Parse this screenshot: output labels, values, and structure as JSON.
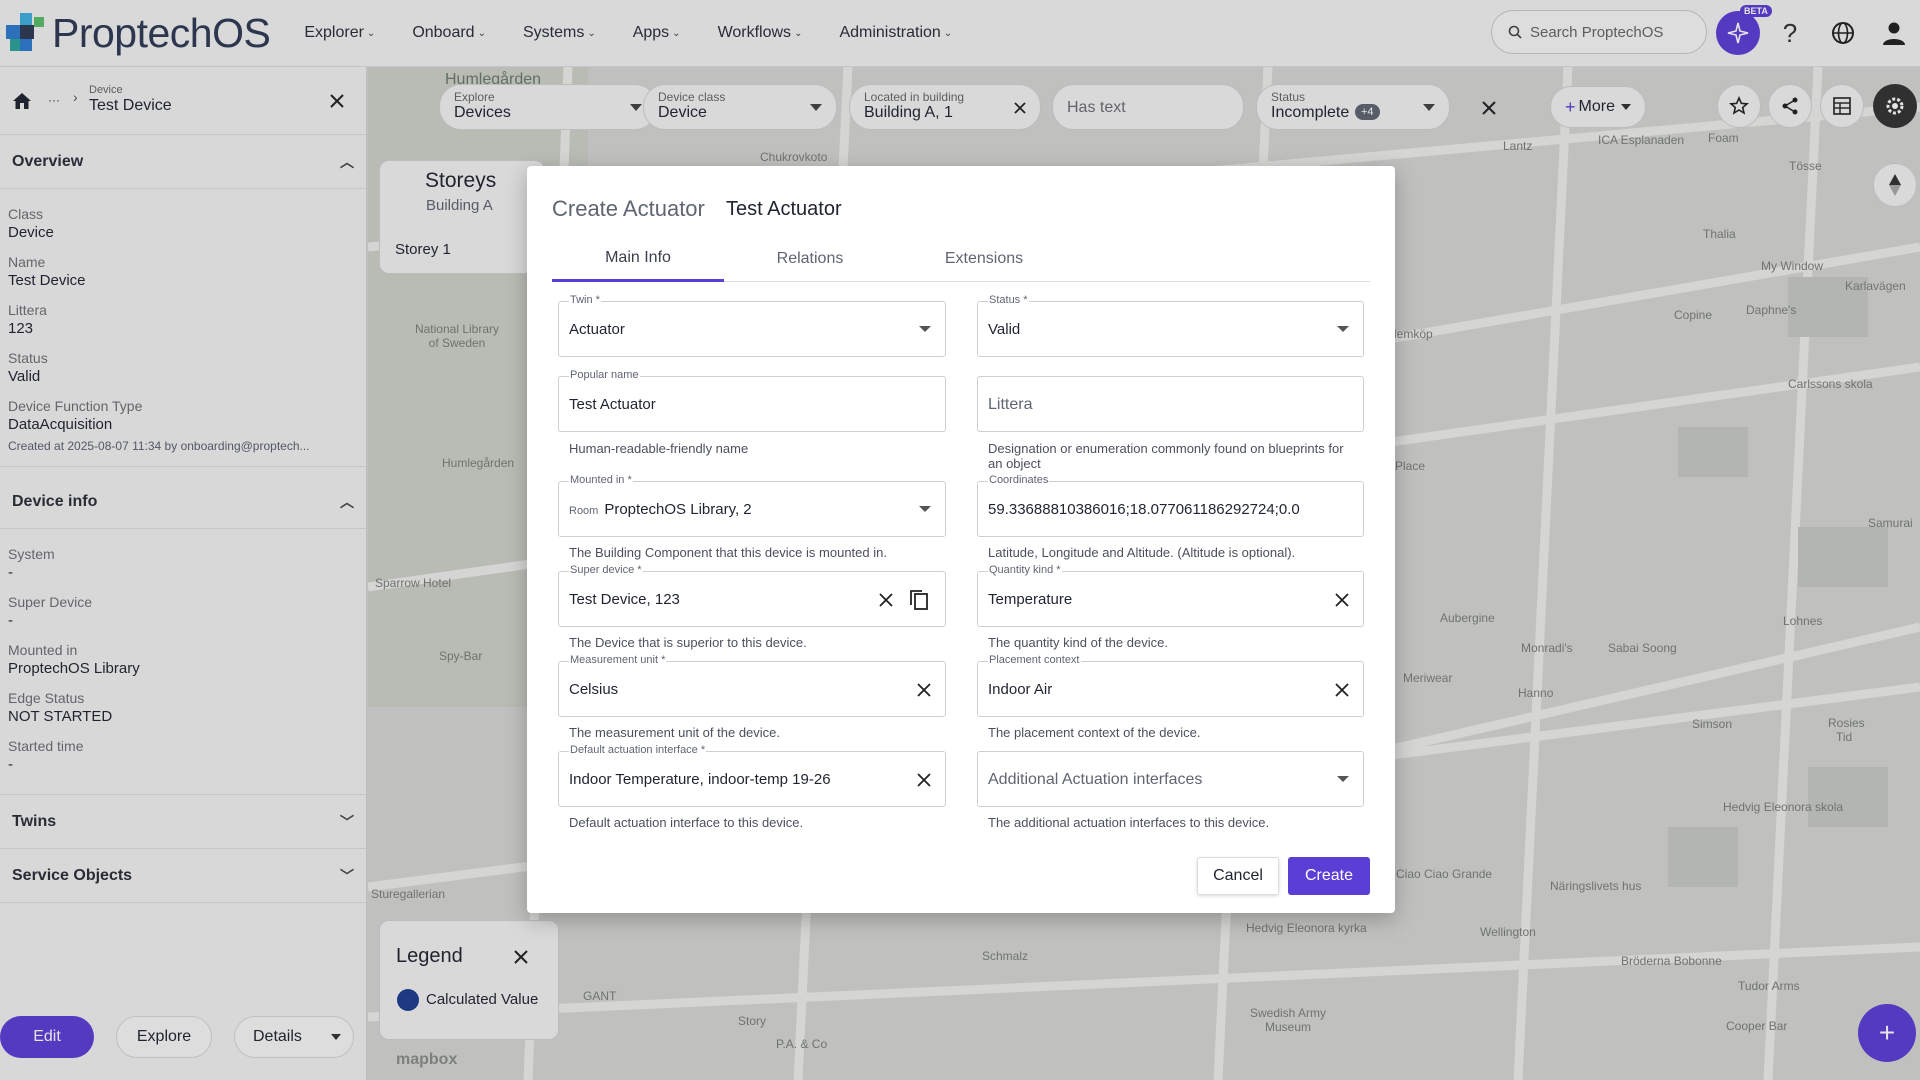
{
  "app": {
    "name": "ProptechOS"
  },
  "nav": [
    "Explorer",
    "Onboard",
    "Systems",
    "Apps",
    "Workflows",
    "Administration"
  ],
  "search": {
    "placeholder": "Search ProptechOS"
  },
  "beta_label": "BETA",
  "left_panel": {
    "breadcrumb_ellipsis": "···",
    "breadcrumb_small": "Device",
    "breadcrumb_main": "Test Device",
    "overview_title": "Overview",
    "overview_fields": [
      {
        "label": "Class",
        "value": "Device"
      },
      {
        "label": "Name",
        "value": "Test Device"
      },
      {
        "label": "Littera",
        "value": "123"
      },
      {
        "label": "Status",
        "value": "Valid"
      },
      {
        "label": "Device Function Type",
        "value": "DataAcquisition"
      }
    ],
    "created": "Created at 2025-08-07 11:34 by onboarding@proptech...",
    "device_info_title": "Device info",
    "device_info_fields": [
      {
        "label": "System",
        "value": "-"
      },
      {
        "label": "Super Device",
        "value": "-"
      },
      {
        "label": "Mounted in",
        "value": "ProptechOS Library"
      },
      {
        "label": "Edge Status",
        "value": "NOT STARTED"
      },
      {
        "label": "Started time",
        "value": "-"
      }
    ],
    "twins_title": "Twins",
    "service_objects_title": "Service Objects",
    "buttons": {
      "edit": "Edit",
      "explore": "Explore",
      "details": "Details"
    }
  },
  "filters": [
    {
      "label": "Explore",
      "value": "Devices"
    },
    {
      "label": "Device class",
      "value": "Device"
    },
    {
      "label": "Located in building",
      "value": "Building A, 1"
    },
    {
      "label": "",
      "value": "Has text"
    },
    {
      "label": "Status",
      "value": "Incomplete",
      "badge": "+4"
    }
  ],
  "more_label": "More",
  "storeys": {
    "title": "Storeys",
    "building": "Building A",
    "item": "Storey 1"
  },
  "legend": {
    "title": "Legend",
    "item": "Calculated Value",
    "color": "#1d3d8f"
  },
  "map_labels": [
    "Humlegården",
    "Chukrovkoto",
    "National Library of Sweden",
    "Humlegården",
    "Sparrow Hotel",
    "Spy-Bar",
    "Lantz",
    "ICA Esplanaden",
    "Foam",
    "Tösse",
    "Thalia",
    "My Window",
    "Karlavägen",
    "Copine",
    "Daphne's",
    "Carlssons skola",
    "Place",
    "Samurai",
    "Aubergine",
    "Monradi's",
    "Sabai Soong",
    "Lohnes",
    "Meriwear",
    "Hanno",
    "Simson",
    "Rosies",
    "Tid",
    "Hemköp",
    "Hedvig Eleonora skola",
    "Ciao Ciao Grande",
    "Näringslivets hus",
    "Hedvig Eleonora kyrka",
    "Wellington",
    "Bröderna Bobonne",
    "Tudor Arms",
    "Swedish Army Museum",
    "Cooper Bar",
    "P.A. & Co",
    "Story",
    "Sturegallerian",
    "Schmalz",
    "GANT",
    "mapbox"
  ],
  "modal": {
    "title": "Create Actuator",
    "subtitle": "Test Actuator",
    "tabs": [
      "Main Info",
      "Relations",
      "Extensions"
    ],
    "fields": {
      "twin": {
        "label": "Twin *",
        "value": "Actuator"
      },
      "status": {
        "label": "Status *",
        "value": "Valid"
      },
      "popular_name": {
        "label": "Popular name",
        "value": "Test Actuator",
        "help": "Human-readable-friendly name"
      },
      "littera": {
        "placeholder": "Littera",
        "help": "Designation or enumeration commonly found on blueprints for an object"
      },
      "mounted_in": {
        "label": "Mounted in *",
        "prefix": "Room",
        "value": "ProptechOS Library, 2",
        "help": "The Building Component that this device is mounted in."
      },
      "coordinates": {
        "label": "Coordinates",
        "value": "59.33688810386016;18.077061186292724;0.0",
        "help": "Latitude, Longitude and Altitude. (Altitude is optional)."
      },
      "super_device": {
        "label": "Super device *",
        "value": "Test Device, 123",
        "help": "The Device that is superior to this device."
      },
      "quantity_kind": {
        "label": "Quantity kind *",
        "value": "Temperature",
        "help": "The quantity kind of the device."
      },
      "measurement_unit": {
        "label": "Measurement unit *",
        "value": "Celsius",
        "help": "The measurement unit of the device."
      },
      "placement_context": {
        "label": "Placement context",
        "value": "Indoor Air",
        "help": "The placement context of the device."
      },
      "default_actuation": {
        "label": "Default actuation interface *",
        "value": "Indoor Temperature, indoor-temp 19-26",
        "help": "Default actuation interface to this device."
      },
      "additional_actuation": {
        "placeholder": "Additional Actuation interfaces",
        "help": "The additional actuation interfaces to this device."
      }
    },
    "cancel": "Cancel",
    "create": "Create"
  },
  "colors": {
    "accent": "#5b3ed6"
  }
}
